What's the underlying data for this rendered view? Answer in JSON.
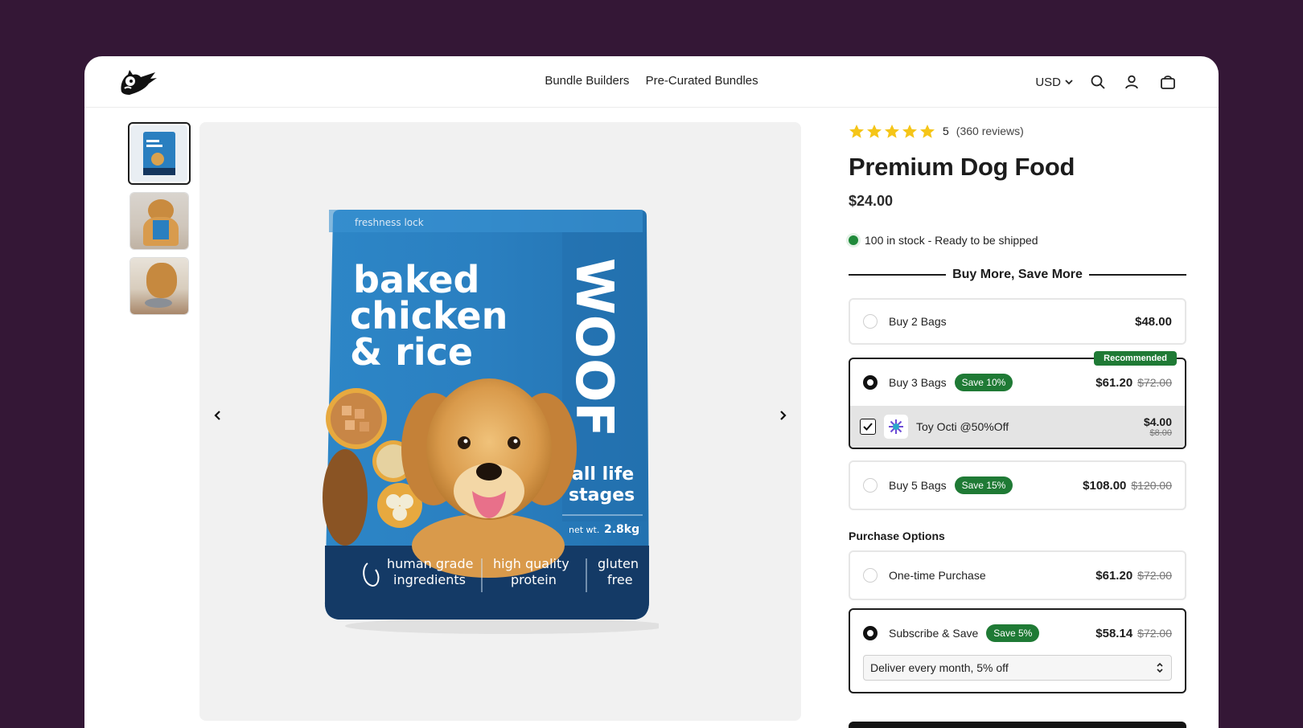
{
  "header": {
    "nav": [
      "Bundle Builders",
      "Pre-Curated Bundles"
    ],
    "currency": "USD",
    "icons": [
      "search-icon",
      "account-icon",
      "cart-icon"
    ]
  },
  "gallery": {
    "thumbnails": [
      "bag-front",
      "dog-holding-bag",
      "dog-eating"
    ],
    "active_index": 0,
    "packaging": {
      "tag": "freshness lock",
      "line1": "baked",
      "line2": "chicken",
      "line3": "& rice",
      "brand": "WOOF",
      "stage1": "all life",
      "stage2": "stages",
      "weight_label": "net wt.",
      "weight": "2.8kg",
      "feature1a": "human grade",
      "feature1b": "ingredients",
      "feature2a": "high quality",
      "feature2b": "protein",
      "feature3a": "gluten",
      "feature3b": "free"
    }
  },
  "product": {
    "rating_value": "5",
    "rating_stars": 5,
    "reviews": "(360 reviews)",
    "title": "Premium Dog Food",
    "price": "$24.00",
    "stock": "100 in stock - Ready to be shipped"
  },
  "bundles": {
    "heading": "Buy More, Save More",
    "options": [
      {
        "label": "Buy 2 Bags",
        "price": "$48.00",
        "selected": false
      },
      {
        "label": "Buy 3 Bags",
        "badge": "Save 10%",
        "price": "$61.20",
        "compare": "$72.00",
        "selected": true,
        "ribbon": "Recommended"
      },
      {
        "label": "Buy 5 Bags",
        "badge": "Save 15%",
        "price": "$108.00",
        "compare": "$120.00",
        "selected": false
      }
    ],
    "addon": {
      "label": "Toy Octi @50%Off",
      "price": "$4.00",
      "compare": "$8.00",
      "checked": true
    }
  },
  "purchase": {
    "heading": "Purchase Options",
    "one_time": {
      "label": "One-time Purchase",
      "price": "$61.20",
      "compare": "$72.00",
      "selected": false
    },
    "subscribe": {
      "label": "Subscribe & Save",
      "badge": "Save 5%",
      "price": "$58.14",
      "compare": "$72.00",
      "selected": true,
      "frequency": "Deliver every month, 5% off"
    }
  },
  "colors": {
    "page_bg": "#341736",
    "accent_green": "#1f7a35",
    "stock_green": "#1f8a3a",
    "star": "#f5c518",
    "bag_blue": "#2a7fc0"
  }
}
